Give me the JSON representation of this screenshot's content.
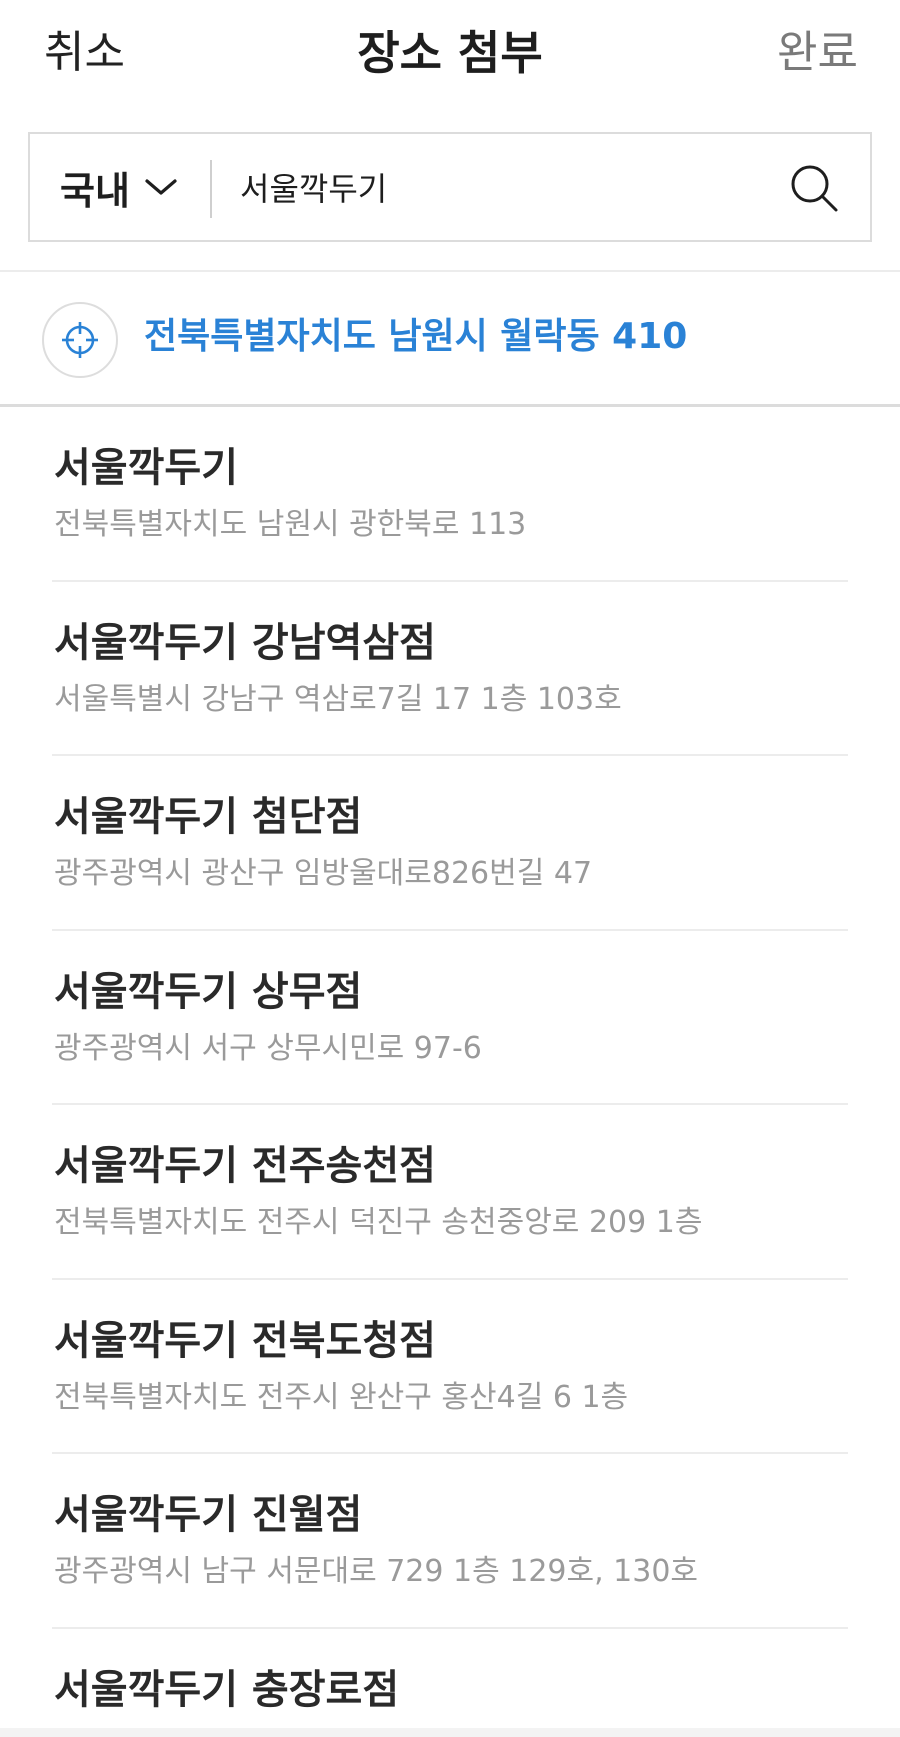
{
  "header": {
    "cancel_label": "취소",
    "title": "장소 첨부",
    "done_label": "완료"
  },
  "search": {
    "scope_label": "국내",
    "query": "서울깍두기"
  },
  "current_location": {
    "address": "전북특별자치도 남원시 월락동 410",
    "color": "#2a82d6"
  },
  "results": [
    {
      "name": "서울깍두기",
      "address": "전북특별자치도 남원시 광한북로 113"
    },
    {
      "name": "서울깍두기 강남역삼점",
      "address": "서울특별시 강남구 역삼로7길 17 1층 103호"
    },
    {
      "name": "서울깍두기 첨단점",
      "address": "광주광역시 광산구 임방울대로826번길 47"
    },
    {
      "name": "서울깍두기 상무점",
      "address": "광주광역시 서구 상무시민로 97-6"
    },
    {
      "name": "서울깍두기 전주송천점",
      "address": "전북특별자치도 전주시 덕진구 송천중앙로 209 1층"
    },
    {
      "name": "서울깍두기 전북도청점",
      "address": "전북특별자치도 전주시 완산구 홍산4길 6 1층"
    },
    {
      "name": "서울깍두기 진월점",
      "address": "광주광역시 남구 서문대로 729 1층 129호, 130호"
    },
    {
      "name": "서울깍두기 충장로점",
      "address": ""
    }
  ]
}
